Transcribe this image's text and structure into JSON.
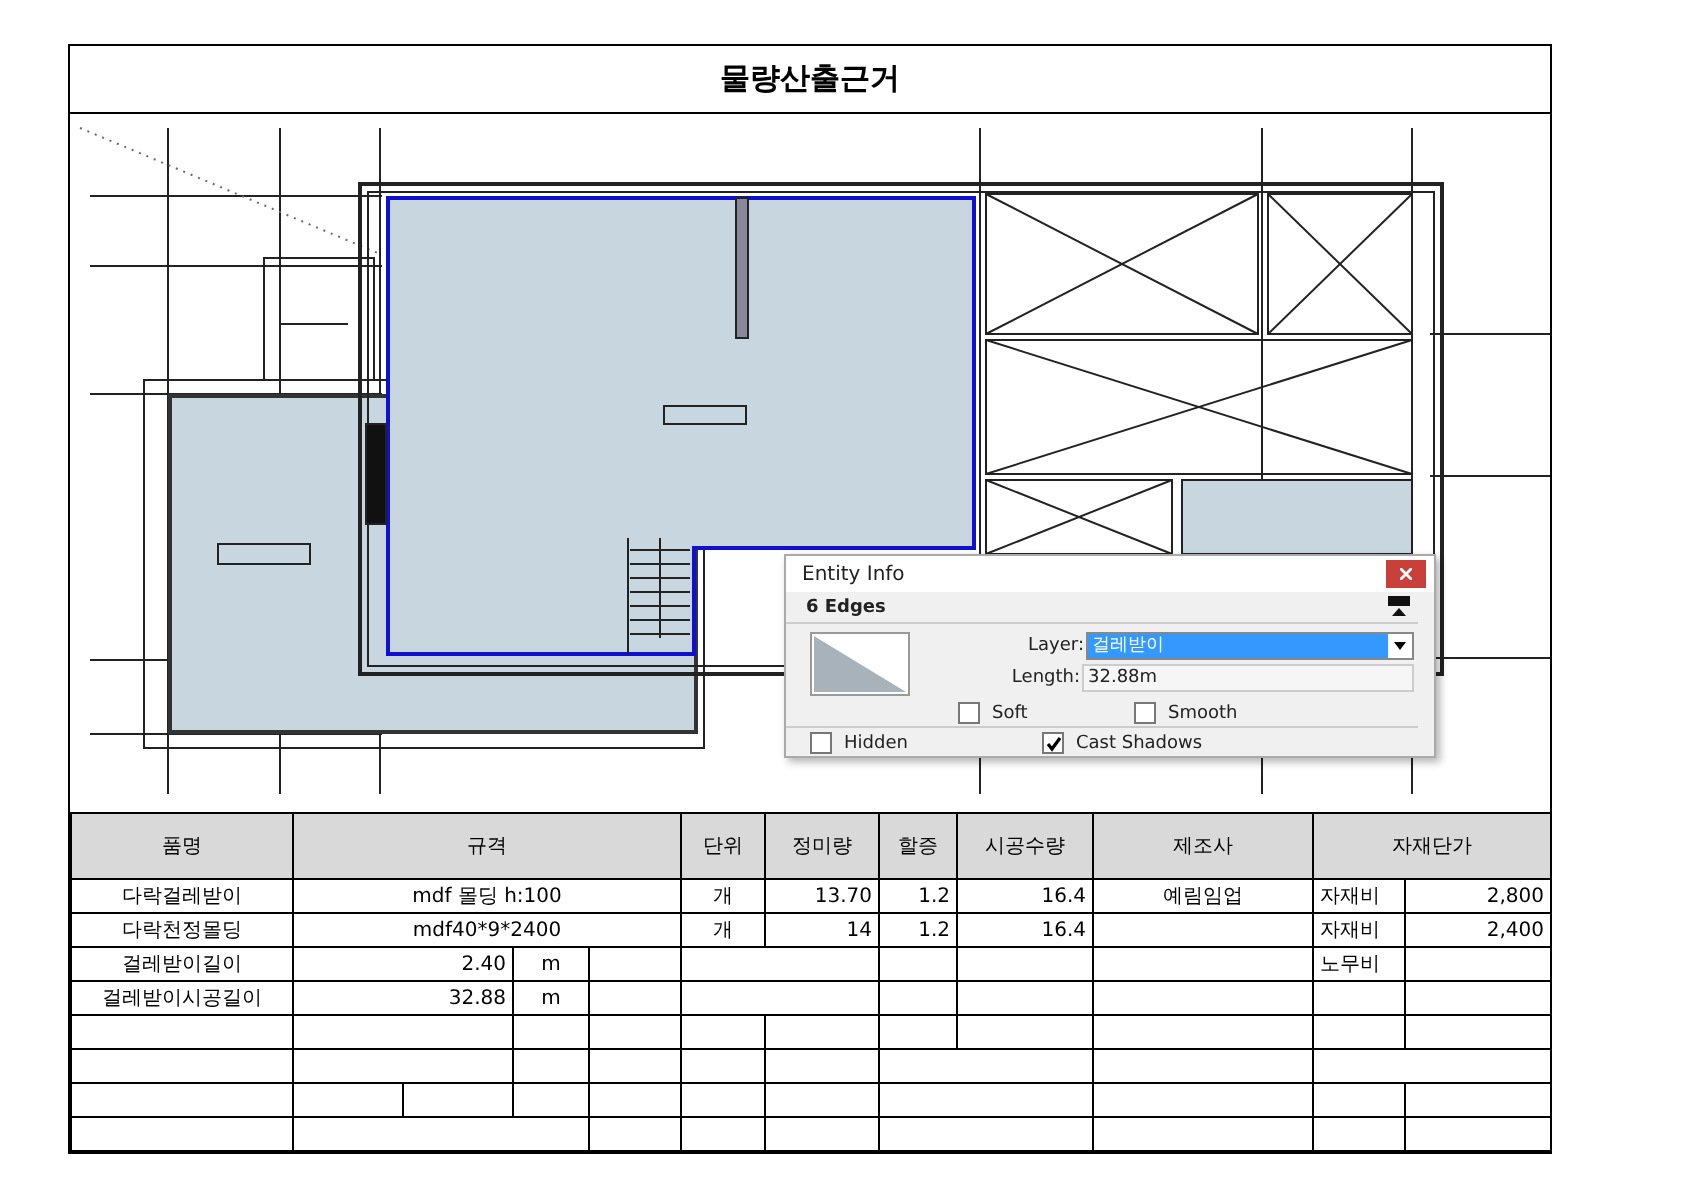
{
  "document": {
    "title": "물량산출근거"
  },
  "entity_info": {
    "title": "Entity Info",
    "selection": "6 Edges",
    "layer_label": "Layer:",
    "layer_value": "걸레받이",
    "length_label": "Length:",
    "length_value": "32.88m",
    "checkboxes": [
      {
        "label": "Soft",
        "checked": false
      },
      {
        "label": "Smooth",
        "checked": false
      },
      {
        "label": "Hidden",
        "checked": false
      },
      {
        "label": "Cast Shadows",
        "checked": true
      }
    ]
  },
  "table": {
    "columns": [
      "품명",
      "규격",
      "단위",
      "정미량",
      "할증",
      "시공수량",
      "제조사",
      "자재단가"
    ],
    "rows": [
      {
        "kind": "material",
        "item": "다락걸레받이",
        "spec": "mdf 몰딩 h:100",
        "unit": "개",
        "net_qty": "13.70",
        "surcharge": "1.2",
        "work_qty": "16.4",
        "maker": "예림임업",
        "cost_type": "자재비",
        "unit_price": "2,800"
      },
      {
        "kind": "material",
        "item": "다락천정몰딩",
        "spec": "mdf40*9*2400",
        "unit": "개",
        "net_qty": "14",
        "surcharge": "1.2",
        "work_qty": "16.4",
        "cost_type": "자재비",
        "unit_price": "2,400"
      },
      {
        "kind": "length",
        "item": "걸레받이길이",
        "value": "2.40",
        "unit": "m",
        "cost_type": "노무비"
      },
      {
        "kind": "length",
        "item": "걸레받이시공길이",
        "value": "32.88",
        "unit": "m"
      }
    ]
  }
}
